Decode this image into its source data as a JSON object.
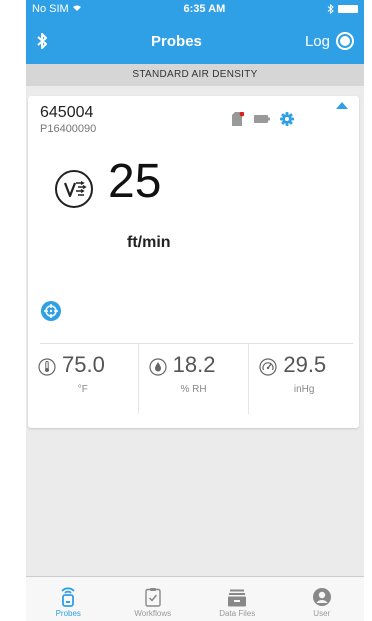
{
  "status": {
    "carrier": "No SIM",
    "time": "6:35 AM"
  },
  "header": {
    "title": "Probes",
    "log_label": "Log"
  },
  "banner": {
    "text": "STANDARD AIR DENSITY"
  },
  "probe": {
    "serial": "645004",
    "model": "P16400090",
    "reading": "25",
    "unit": "ft/min"
  },
  "readings": [
    {
      "value": "75.0",
      "unit": "°F",
      "icon": "thermometer-icon"
    },
    {
      "value": "18.2",
      "unit": "% RH",
      "icon": "humidity-icon"
    },
    {
      "value": "29.5",
      "unit": "inHg",
      "icon": "gauge-icon"
    }
  ],
  "tabs": [
    {
      "label": "Probes",
      "icon": "probe-icon"
    },
    {
      "label": "Workflows",
      "icon": "clipboard-icon"
    },
    {
      "label": "Data Files",
      "icon": "data-files-icon"
    },
    {
      "label": "User",
      "icon": "user-icon"
    }
  ],
  "colors": {
    "accent": "#2fa0e6",
    "background": "#ebebeb",
    "alert": "#e0201a"
  }
}
